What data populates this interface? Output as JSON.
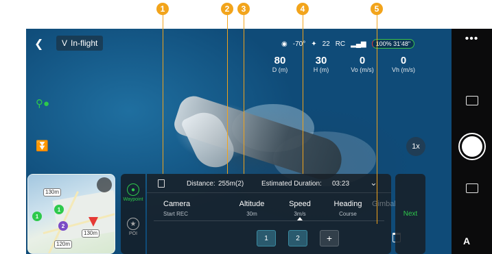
{
  "callouts": [
    "1",
    "2",
    "3",
    "4",
    "5"
  ],
  "header": {
    "back_icon": "back-arrow-icon",
    "mode_label": "In-flight",
    "mode_prefix": "V",
    "obstacle_icon": "obstacle-sensing-icon",
    "temperature": "-70°",
    "satellites": "22",
    "rc_label": "RC",
    "battery": "100% 31'48\""
  },
  "telemetry": [
    {
      "value": "80",
      "label": "D (m)"
    },
    {
      "value": "30",
      "label": "H (m)"
    },
    {
      "value": "0",
      "label": "Vo (m/s)"
    },
    {
      "value": "0",
      "label": "Vh (m/s)"
    }
  ],
  "zoom": "1x",
  "minimap": {
    "labels": [
      "130m",
      "120m",
      "130m"
    ],
    "pins": [
      "1",
      "2",
      "1"
    ]
  },
  "side_tabs": [
    {
      "label": "Waypoint",
      "active": true
    },
    {
      "label": "POI",
      "active": false
    }
  ],
  "summary": {
    "distance_label": "Distance:",
    "distance_value": "255m(2)",
    "duration_label": "Estimated Duration:",
    "duration_value": "03:23"
  },
  "params": [
    {
      "name": "Camera",
      "value": "Start REC"
    },
    {
      "name": "Altitude",
      "value": "30m"
    },
    {
      "name": "Speed",
      "value": "3m/s"
    },
    {
      "name": "Heading",
      "value": "Course"
    },
    {
      "name": "Gimbal",
      "value": ""
    }
  ],
  "waypoints": [
    "1",
    "2"
  ],
  "add_label": "+",
  "next_label": "Next",
  "more_label": "•••",
  "camera_mode": "A"
}
